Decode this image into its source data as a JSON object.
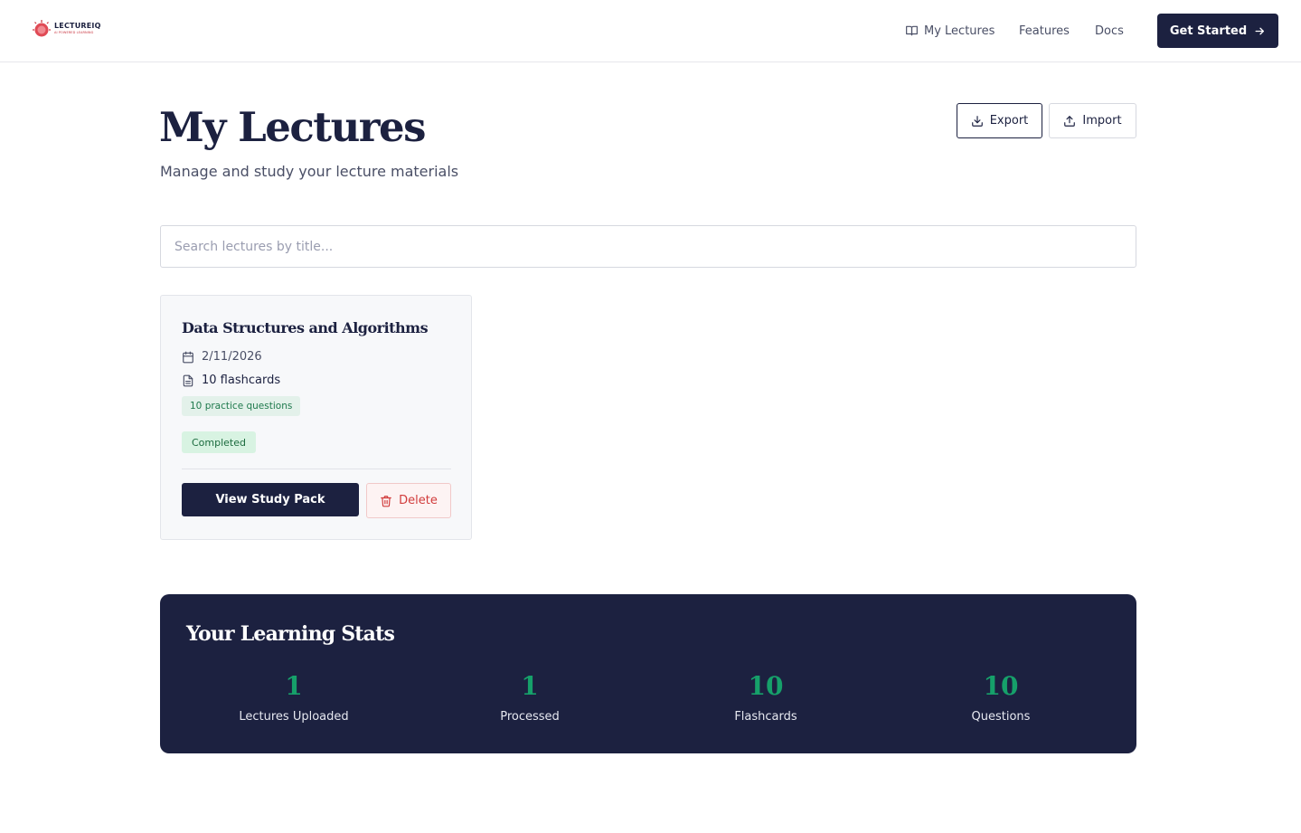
{
  "header": {
    "logo_name": "LECTUREIQ",
    "logo_tagline": "AI POWERED LEARNING",
    "nav": {
      "my_lectures": "My Lectures",
      "features": "Features",
      "docs": "Docs"
    },
    "cta_label": "Get Started"
  },
  "page": {
    "title": "My Lectures",
    "subtitle": "Manage and study your lecture materials",
    "export_label": "Export",
    "import_label": "Import"
  },
  "search": {
    "placeholder": "Search lectures by title..."
  },
  "lectures": [
    {
      "title": "Data Structures and Algorithms",
      "date": "2/11/2026",
      "flashcards": "10 flashcards",
      "questions": "10 practice questions",
      "status": "Completed",
      "view_label": "View Study Pack",
      "delete_label": "Delete"
    }
  ],
  "stats": {
    "title": "Your Learning Stats",
    "items": [
      {
        "value": "1",
        "label": "Lectures Uploaded"
      },
      {
        "value": "1",
        "label": "Processed"
      },
      {
        "value": "10",
        "label": "Flashcards"
      },
      {
        "value": "10",
        "label": "Questions"
      }
    ]
  },
  "colors": {
    "navy": "#1c2140",
    "accent_green": "#16a06a",
    "danger_red": "#d13b3b",
    "logo_red": "#c8343f"
  },
  "icons": [
    "lectureiq-logo-icon",
    "book-icon",
    "arrow-right-icon",
    "download-icon",
    "upload-icon",
    "calendar-icon",
    "file-icon",
    "trash-icon"
  ]
}
